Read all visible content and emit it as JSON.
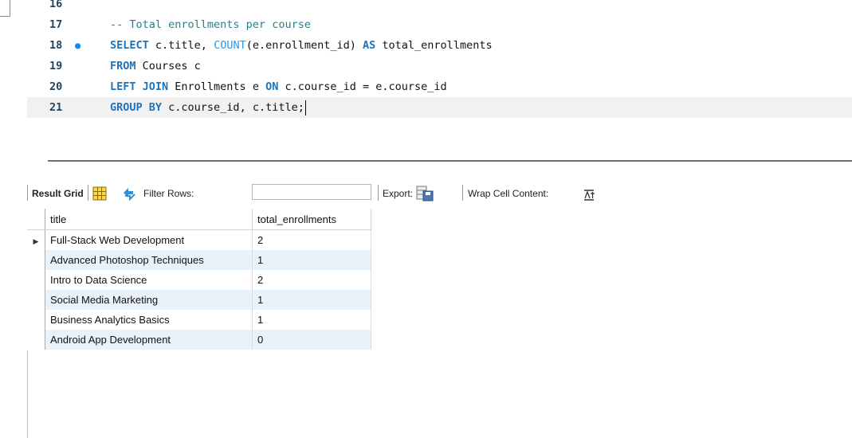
{
  "editor": {
    "lines": [
      {
        "num": "16",
        "tokens": []
      },
      {
        "num": "17",
        "tokens": [
          {
            "t": "-- Total enrollments per course",
            "c": "cm"
          }
        ]
      },
      {
        "num": "18",
        "dot": "●",
        "tokens": [
          {
            "t": "SELECT",
            "c": "kw"
          },
          {
            "t": " c.title, ",
            "c": "op"
          },
          {
            "t": "COUNT",
            "c": "fn"
          },
          {
            "t": "(e.enrollment_id) ",
            "c": "op"
          },
          {
            "t": "AS",
            "c": "kw"
          },
          {
            "t": " total_enrollments",
            "c": "op"
          }
        ]
      },
      {
        "num": "19",
        "tokens": [
          {
            "t": "FROM",
            "c": "kw"
          },
          {
            "t": " Courses c",
            "c": "op"
          }
        ]
      },
      {
        "num": "20",
        "tokens": [
          {
            "t": "LEFT JOIN",
            "c": "kw"
          },
          {
            "t": " Enrollments e ",
            "c": "op"
          },
          {
            "t": "ON",
            "c": "kw"
          },
          {
            "t": " c.course_id = e.course_id",
            "c": "op"
          }
        ]
      },
      {
        "num": "21",
        "current": true,
        "tokens": [
          {
            "t": "GROUP BY",
            "c": "kw"
          },
          {
            "t": " c.course_id, c.title;",
            "c": "op"
          }
        ]
      }
    ]
  },
  "toolbar": {
    "result_grid_label": "Result Grid",
    "filter_rows_label": "Filter Rows:",
    "filter_value": "",
    "export_label": "Export:",
    "wrap_label": "Wrap Cell Content:",
    "grid_icon": "grid-view-icon",
    "refresh_icon": "refresh-icon",
    "export_icon": "export-icon",
    "wrap_icon": "wrap-cell-icon"
  },
  "grid": {
    "columns": [
      "title",
      "total_enrollments"
    ],
    "rows": [
      {
        "title": "Full-Stack Web Development",
        "total_enrollments": "2"
      },
      {
        "title": "Advanced Photoshop Techniques",
        "total_enrollments": "1"
      },
      {
        "title": "Intro to Data Science",
        "total_enrollments": "2"
      },
      {
        "title": "Social Media Marketing",
        "total_enrollments": "1"
      },
      {
        "title": "Business Analytics Basics",
        "total_enrollments": "1"
      },
      {
        "title": "Android App Development",
        "total_enrollments": "0"
      }
    ],
    "current_row_marker": "▶"
  }
}
